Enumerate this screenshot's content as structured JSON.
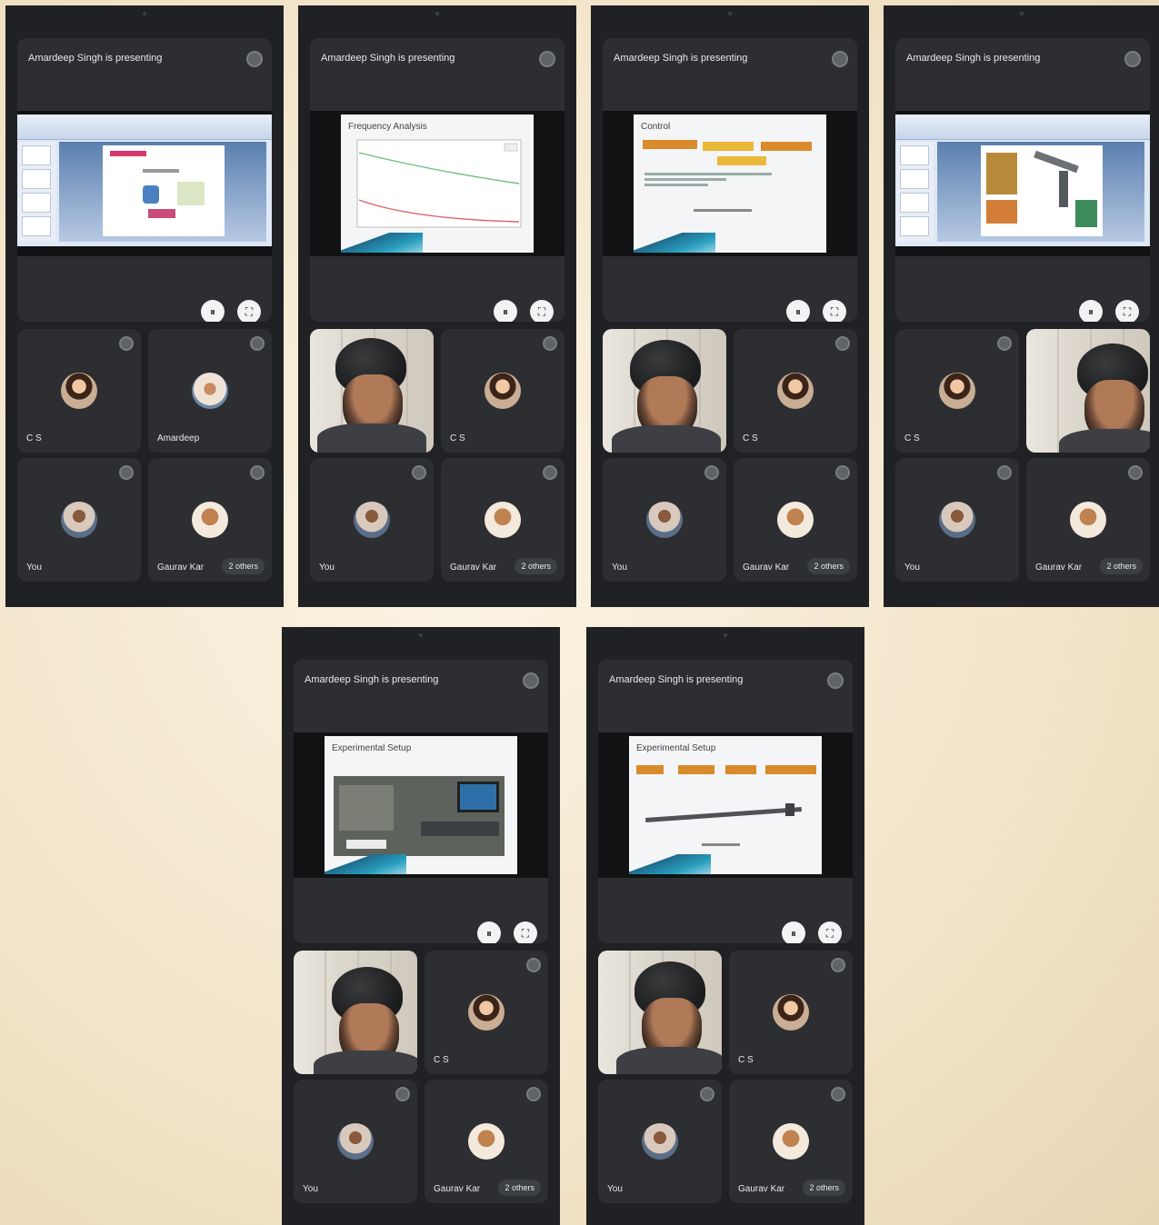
{
  "meeting": {
    "presenting_label": "Amardeep Singh is presenting",
    "participants": {
      "cs": "C S",
      "amardeep": "Amardeep",
      "you": "You",
      "gaurav": "Gaurav Kar",
      "others": "2 others"
    }
  },
  "slides": {
    "frequency": {
      "title": "Frequency Analysis"
    },
    "control": {
      "title": "Control"
    },
    "exp_setup_1": {
      "title": "Experimental Setup"
    },
    "exp_setup_2": {
      "title": "Experimental Setup"
    }
  },
  "icons": {
    "pin": "pin-icon",
    "pause": "pause-icon",
    "fullscreen": "fullscreen-icon"
  },
  "colors": {
    "phone_bg": "#202124",
    "tile_bg": "#2d2e31",
    "accent_orange": "#d98a2a",
    "accent_yellow": "#e9b93a"
  }
}
